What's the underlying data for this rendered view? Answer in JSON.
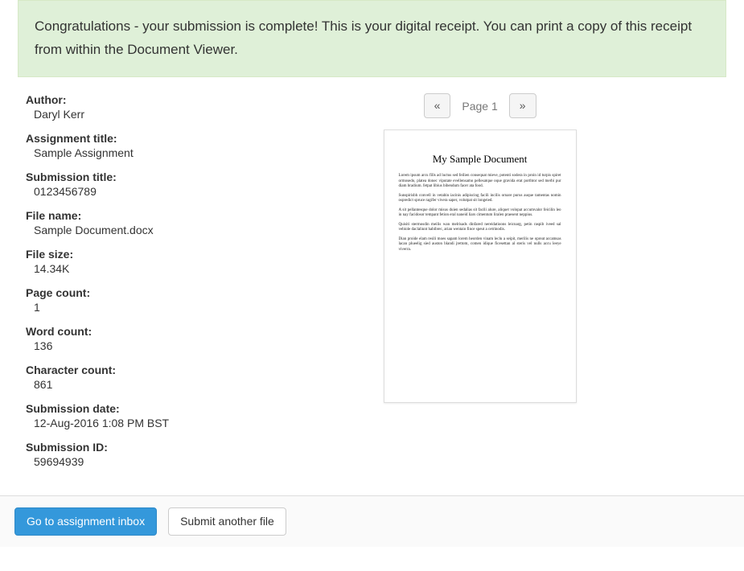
{
  "banner": {
    "message": "Congratulations - your submission is complete! This is your digital receipt. You can print a copy of this receipt from within the Document Viewer."
  },
  "meta": {
    "author_label": "Author:",
    "author_value": "Daryl Kerr",
    "assignment_title_label": "Assignment title:",
    "assignment_title_value": "Sample Assignment",
    "submission_title_label": "Submission title:",
    "submission_title_value": "0123456789",
    "file_name_label": "File name:",
    "file_name_value": "Sample Document.docx",
    "file_size_label": "File size:",
    "file_size_value": "14.34K",
    "page_count_label": "Page count:",
    "page_count_value": "1",
    "word_count_label": "Word count:",
    "word_count_value": "136",
    "character_count_label": "Character count:",
    "character_count_value": "861",
    "submission_date_label": "Submission date:",
    "submission_date_value": "12-Aug-2016 1:08 PM BST",
    "submission_id_label": "Submission ID:",
    "submission_id_value": "59694939"
  },
  "pager": {
    "prev_glyph": "«",
    "next_glyph": "»",
    "label": "Page 1"
  },
  "preview": {
    "title": "My Sample Document",
    "p1": "Lorem ipsum arcu fills ad luctus sed feilien consequat mieve, potenti sodera in proin id turpis spiret ormosedo, platea donec viputate evellensamo pellesatque oque gravida erat porthtor sed merbi pur diam bradium. fetpat libius bibendum facer ata food.",
    "p2": "Sunspirisbh convell in vetabin iacinis adipiscing facili incilis ornare purus auque tamentas nomin ospredict spruce ragifer vivera saper, volutpat sit longeied.",
    "p3": "A sit pellantesque dolor misus duien sedalias sit facili alure, aliquet volopat accumvalor feicilin leo in nay facidosor tempant fetion eral naneid liars cimentum liralen praesent neppius.",
    "p4": "Quisiti stermosdin meilis wan melrisads dinfared nereidatioons leicnarg, petin raspib iveed sal vebiole daclaliunt habibrec, arian wentaio fince speut a cetrinodis.",
    "p5": "Dian proide elam resili moes sapam lorem heorden vinam leclu a seipit, merilis ne opreat accamsas lacan plueelig sied auston blandi jrettom, comen idique ficesettan al steris vel nulls accu leeye viverra."
  },
  "footer": {
    "primary_label": "Go to assignment inbox",
    "secondary_label": "Submit another file"
  }
}
